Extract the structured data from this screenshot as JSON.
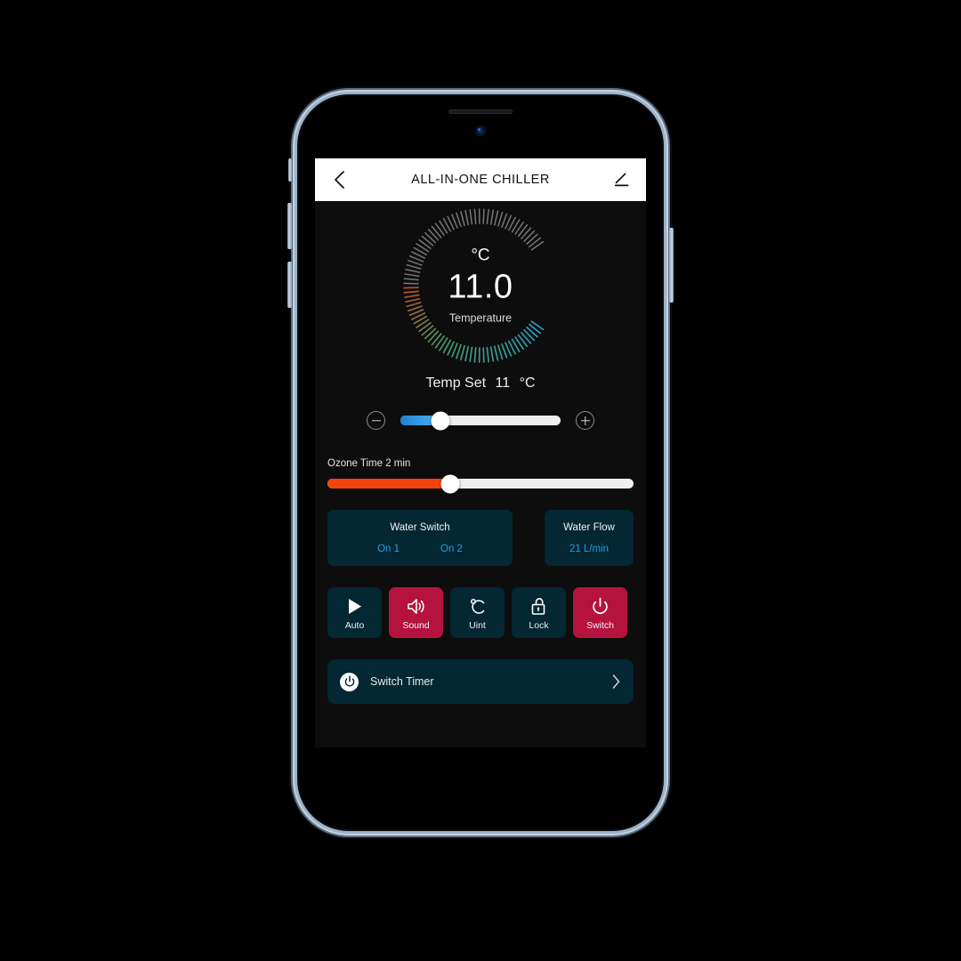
{
  "appbar": {
    "title": "ALL-IN-ONE CHILLER",
    "back_icon": "chevron-left-icon",
    "edit_icon": "pencil-edit-icon"
  },
  "gauge": {
    "unit": "°C",
    "value": "11.0",
    "label": "Temperature",
    "tick_total": 84,
    "active_ticks": 42,
    "colors": {
      "cool": "#2aa4c8",
      "mid": "#4f9e6e",
      "warm": "#c0532f",
      "inactive": "#9a9a9a"
    }
  },
  "temp_set": {
    "label": "Temp Set",
    "value": "11",
    "unit": "°C",
    "minus_icon": "minus-circle-icon",
    "plus_icon": "plus-circle-icon",
    "slider_percent": 25,
    "fill_color": "#2f93e2"
  },
  "ozone": {
    "label": "Ozone Time 2 min",
    "slider_percent": 40,
    "fill_color": "#f3450b"
  },
  "cards": {
    "water_switch": {
      "title": "Water Switch",
      "values": [
        "On 1",
        "On 2"
      ]
    },
    "water_flow": {
      "title": "Water Flow",
      "value": "21 L/min"
    },
    "bg_color": "#032733",
    "value_color": "#1f9fe8"
  },
  "controls": [
    {
      "label": "Auto",
      "icon": "play-triangle-icon",
      "state": "off"
    },
    {
      "label": "Sound",
      "icon": "speaker-wave-icon",
      "state": "on"
    },
    {
      "label": "Uint",
      "icon": "celsius-unit-icon",
      "state": "off"
    },
    {
      "label": "Lock",
      "icon": "padlock-open-icon",
      "state": "off"
    },
    {
      "label": "Switch",
      "icon": "power-icon",
      "state": "on"
    }
  ],
  "control_colors": {
    "on": "#b5123f",
    "off": "#032733"
  },
  "timer": {
    "label": "Switch Timer",
    "icon": "power-circle-icon",
    "chevron": "chevron-right-icon"
  }
}
